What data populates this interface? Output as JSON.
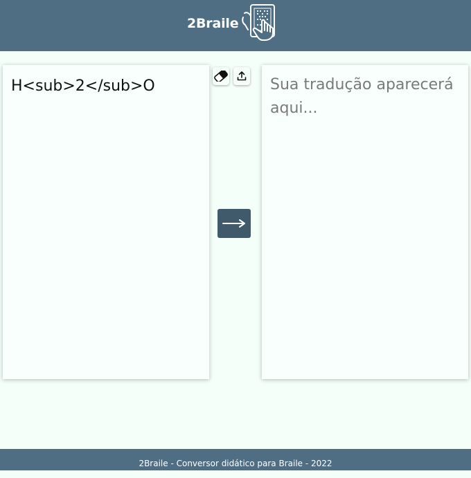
{
  "header": {
    "brand_name": "2Braile",
    "logo_icon": "braille-tablet-hand-icon"
  },
  "editor": {
    "input_value": "H<sub>2</sub>O",
    "output_placeholder": "Sua tradução aparecerá aqui..."
  },
  "toolbar": {
    "erase_icon": "eraser-icon",
    "upload_icon": "upload-icon",
    "convert_icon": "arrow-right-icon"
  },
  "footer": {
    "text": "2Braile - Conversor didático para Braile - 2022"
  },
  "colors": {
    "header_bg": "#506e83",
    "page_bg": "#f5fffa",
    "button_bg": "#40596b",
    "placeholder": "#7a7a7a"
  }
}
